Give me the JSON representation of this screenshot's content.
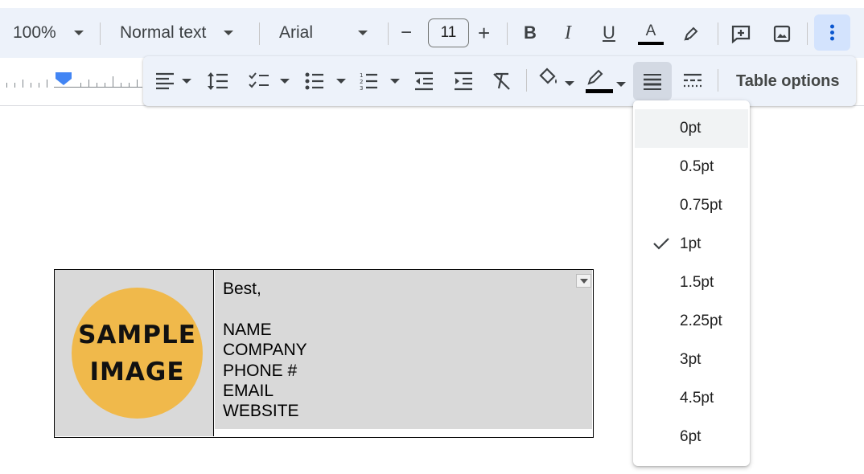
{
  "toolbar": {
    "zoom": "100%",
    "style": "Normal text",
    "font": "Arial",
    "font_size": "11",
    "minus": "−",
    "plus": "+",
    "bold": "B",
    "italic": "I",
    "underline": "U",
    "text_color": "A"
  },
  "overflow_toolbar": {
    "table_options": "Table options"
  },
  "border_width_menu": {
    "items": [
      "0pt",
      "0.5pt",
      "0.75pt",
      "1pt",
      "1.5pt",
      "2.25pt",
      "3pt",
      "4.5pt",
      "6pt"
    ],
    "selected": "1pt",
    "highlighted": "0pt"
  },
  "document": {
    "image_text": [
      "SAMPLE",
      "IMAGE"
    ],
    "signature": {
      "closing": "Best,",
      "lines": [
        "NAME",
        "COMPANY",
        "PHONE #",
        "EMAIL",
        "WEBSITE"
      ]
    }
  },
  "colors": {
    "toolbar_bg": "#edf2fa",
    "active_button": "#d3e3fd",
    "cell_bg": "#d9d9d9",
    "circle": "#f0b94b",
    "ruler_marker": "#4285f4"
  }
}
